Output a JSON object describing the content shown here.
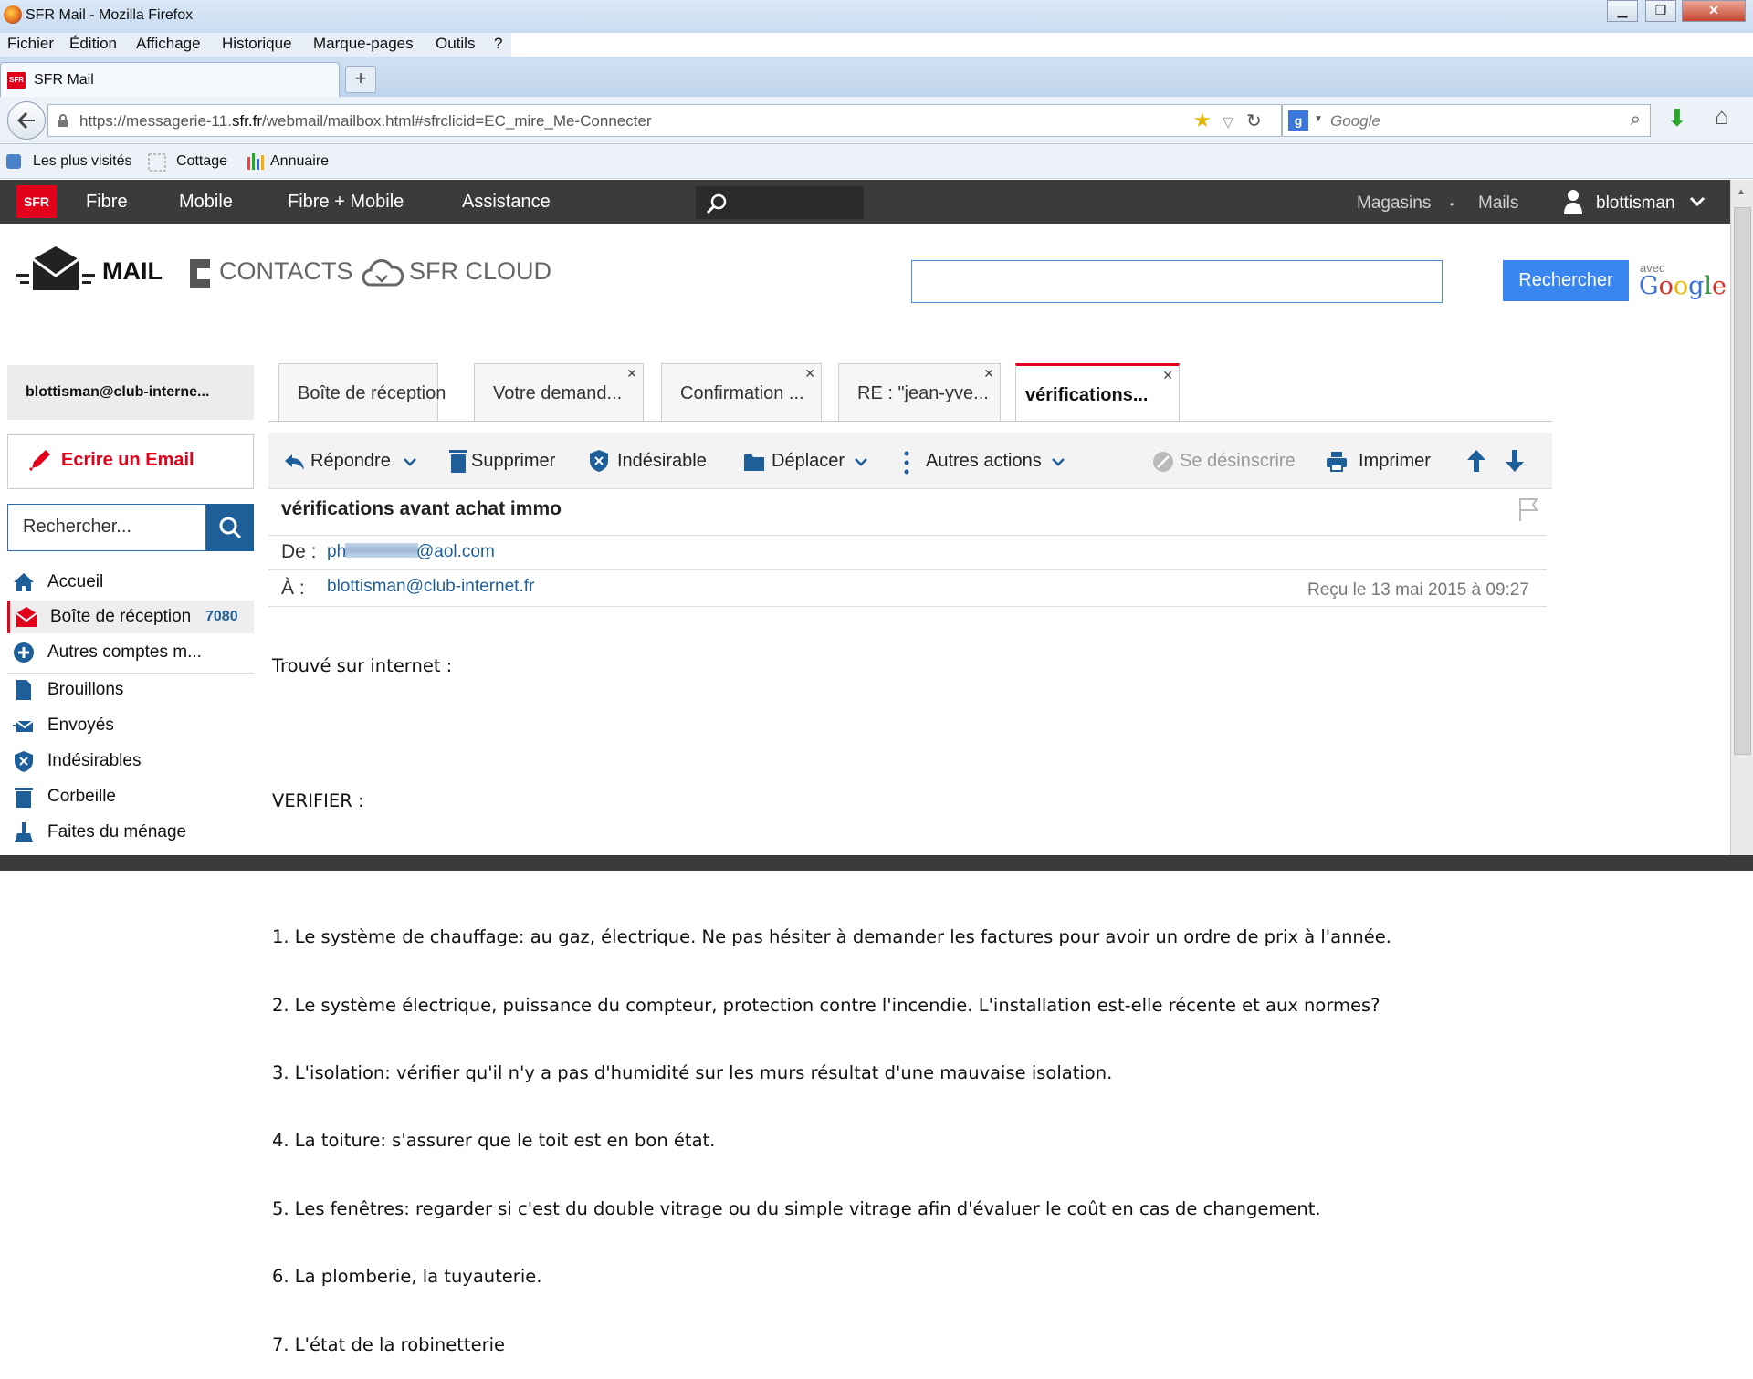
{
  "window": {
    "title": "SFR Mail - Mozilla Firefox",
    "minimize": "▁",
    "maximize": "❐",
    "close": "✕"
  },
  "menu": [
    "Fichier",
    "Édition",
    "Affichage",
    "Historique",
    "Marque-pages",
    "Outils",
    "?"
  ],
  "browser_tab": {
    "title": "SFR Mail",
    "new_tab": "+"
  },
  "nav": {
    "url_prefix": "https://messagerie-11.",
    "url_domain": "sfr.fr",
    "url_suffix": "/webmail/mailbox.html#sfrclicid=EC_mire_Me-Connecter",
    "search_placeholder": "Google"
  },
  "bookmarks": [
    "Les plus visités",
    "Cottage",
    "Annuaire"
  ],
  "sfr_nav": {
    "logo": "SFR",
    "items": [
      "Fibre",
      "Mobile",
      "Fibre + Mobile",
      "Assistance"
    ],
    "right": [
      "Magasins",
      "•",
      "Mails"
    ],
    "user": "blottisman"
  },
  "apps": {
    "mail": "MAIL",
    "contacts": "CONTACTS",
    "cloud": "SFR CLOUD"
  },
  "search": {
    "button": "Rechercher",
    "avec": "avec",
    "google": "Google"
  },
  "sidebar": {
    "account": "blottisman@club-interne...",
    "compose": "Ecrire un Email",
    "search_placeholder": "Rechercher...",
    "folders": [
      {
        "label": "Accueil",
        "icon": "home-icon"
      },
      {
        "label": "Boîte de réception",
        "count": "7080",
        "icon": "inbox-icon"
      },
      {
        "label": "Autres comptes m...",
        "icon": "plus-circle-icon"
      },
      {
        "label": "Brouillons",
        "icon": "draft-icon"
      },
      {
        "label": "Envoyés",
        "icon": "sent-icon"
      },
      {
        "label": "Indésirables",
        "icon": "shield-icon"
      },
      {
        "label": "Corbeille",
        "icon": "trash-icon"
      },
      {
        "label": "Faites du ménage",
        "icon": "broom-icon"
      }
    ]
  },
  "mail_tabs": [
    "Boîte de réception",
    "Votre demand...",
    "Confirmation ...",
    "RE : \"jean-yve...",
    "vérifications..."
  ],
  "toolbar": {
    "reply": "Répondre",
    "delete": "Supprimer",
    "spam": "Indésirable",
    "move": "Déplacer",
    "more": "Autres actions",
    "unsubscribe": "Se désinscrire",
    "print": "Imprimer"
  },
  "message": {
    "subject": "vérifications avant achat immo",
    "from_label": "De :",
    "from_start": "ph",
    "from_end": "@aol.com",
    "to_label": "À :",
    "to": "blottisman@club-internet.fr",
    "received": "Reçu le 13 mai 2015 à 09:27",
    "body": [
      "Trouvé sur internet :",
      "",
      "VERIFIER :",
      "",
      "1. Le système de chauffage: au gaz, électrique. Ne pas hésiter à demander les factures pour avoir un ordre de prix à l'année.",
      "2. Le système électrique, puissance du compteur, protection contre l'incendie. L'installation est-elle récente et aux normes?",
      "3. L'isolation: vérifier qu'il n'y a pas d'humidité sur les murs résultat d'une mauvaise isolation.",
      "4. La toiture: s'assurer que le toit est en bon état.",
      "5. Les fenêtres: regarder si c'est du double vitrage ou du simple vitrage afin d'évaluer le coût en cas de changement.",
      "6. La plomberie, la tuyauterie.",
      "7. L'état de la robinetterie"
    ]
  },
  "colors": {
    "sfr_red": "#e2001a",
    "sfr_dark": "#3b3b3b",
    "link_blue": "#1f5f99",
    "button_blue": "#3a86f0"
  }
}
